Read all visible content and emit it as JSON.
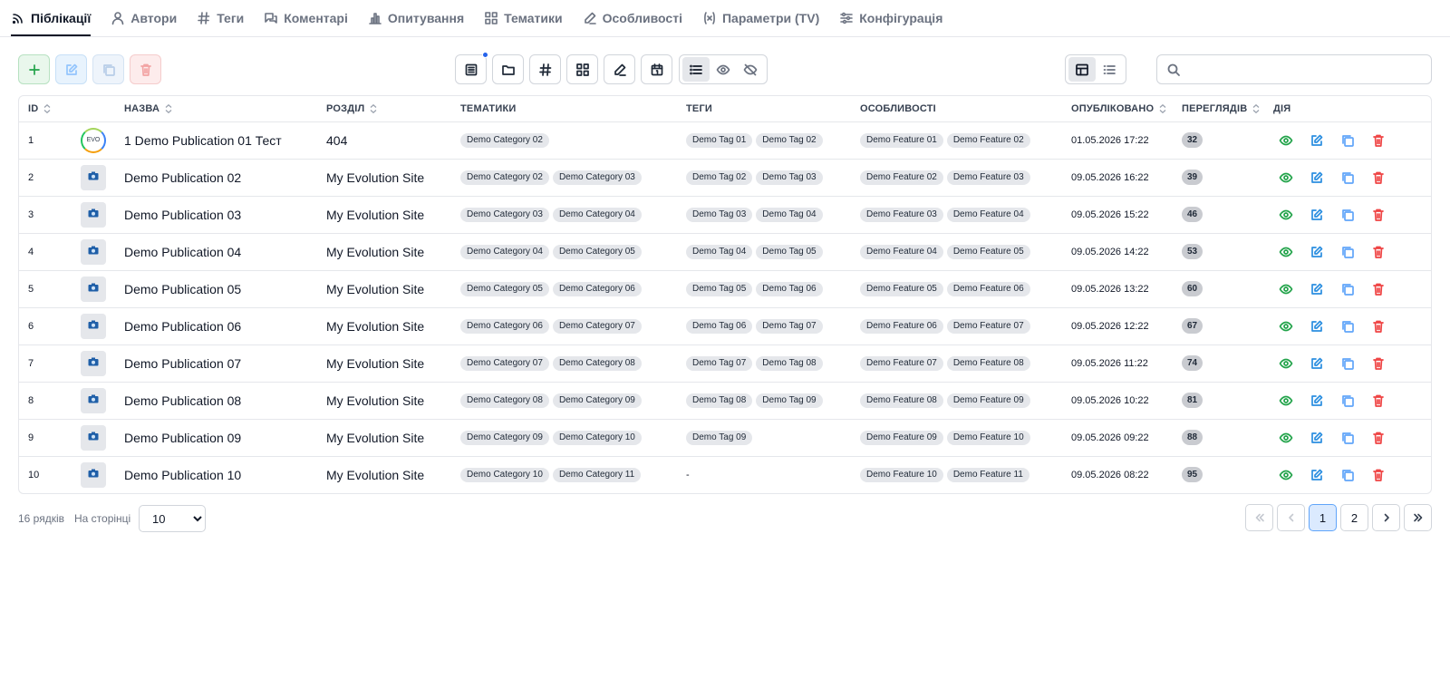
{
  "tabs": [
    {
      "label": "Піблікації",
      "icon": "rss-icon",
      "active": true
    },
    {
      "label": "Автори",
      "icon": "user-icon"
    },
    {
      "label": "Теги",
      "icon": "hash-icon"
    },
    {
      "label": "Коментарі",
      "icon": "comments-icon"
    },
    {
      "label": "Опитування",
      "icon": "bar-chart-icon"
    },
    {
      "label": "Тематики",
      "icon": "grid-icon"
    },
    {
      "label": "Особливості",
      "icon": "pen-icon"
    },
    {
      "label": "Параметри (TV)",
      "icon": "variable-icon"
    },
    {
      "label": "Конфігурація",
      "icon": "sliders-icon"
    }
  ],
  "toolbar": {
    "left_buttons": [
      "add-icon",
      "edit-icon",
      "copy-icon",
      "delete-icon"
    ],
    "center_buttons": [
      "document-icon",
      "folder-icon",
      "hash-icon",
      "grid-icon",
      "pen-icon",
      "calendar-icon"
    ],
    "visibility_toggle": [
      "list-icon",
      "eye-icon",
      "eye-off-icon"
    ],
    "view_toggle": [
      "table-icon",
      "list-view-icon"
    ],
    "search_placeholder": ""
  },
  "columns": {
    "id": "ID",
    "name": "НАЗВА",
    "section": "РОЗДІЛ",
    "categories": "ТЕМАТИКИ",
    "tags": "ТЕГИ",
    "features": "ОСОБЛИВОСТІ",
    "published": "ОПУБЛІКОВАНО",
    "views": "ПЕРЕГЛЯДІВ",
    "action": "ДІЯ"
  },
  "rows": [
    {
      "id": "1",
      "thumb": "logo",
      "logo_text": "EVO",
      "name": "1 Demo Publication 01 Тест",
      "section": "404",
      "categories": [
        "Demo Category 02"
      ],
      "tags": [
        "Demo Tag 01",
        "Demo Tag 02"
      ],
      "tags_empty": "",
      "features": [
        "Demo Feature 01",
        "Demo Feature 02"
      ],
      "published": "01.05.2026 17:22",
      "views": "32"
    },
    {
      "id": "2",
      "thumb": "image",
      "name": "Demo Publication 02",
      "section": "My Evolution Site",
      "categories": [
        "Demo Category 02",
        "Demo Category 03"
      ],
      "tags": [
        "Demo Tag 02",
        "Demo Tag 03"
      ],
      "tags_empty": "",
      "features": [
        "Demo Feature 02",
        "Demo Feature 03"
      ],
      "published": "09.05.2026 16:22",
      "views": "39"
    },
    {
      "id": "3",
      "thumb": "image",
      "name": "Demo Publication 03",
      "section": "My Evolution Site",
      "categories": [
        "Demo Category 03",
        "Demo Category 04"
      ],
      "tags": [
        "Demo Tag 03",
        "Demo Tag 04"
      ],
      "tags_empty": "",
      "features": [
        "Demo Feature 03",
        "Demo Feature 04"
      ],
      "published": "09.05.2026 15:22",
      "views": "46"
    },
    {
      "id": "4",
      "thumb": "image",
      "name": "Demo Publication 04",
      "section": "My Evolution Site",
      "categories": [
        "Demo Category 04",
        "Demo Category 05"
      ],
      "tags": [
        "Demo Tag 04",
        "Demo Tag 05"
      ],
      "tags_empty": "",
      "features": [
        "Demo Feature 04",
        "Demo Feature 05"
      ],
      "published": "09.05.2026 14:22",
      "views": "53"
    },
    {
      "id": "5",
      "thumb": "image",
      "name": "Demo Publication 05",
      "section": "My Evolution Site",
      "categories": [
        "Demo Category 05",
        "Demo Category 06"
      ],
      "tags": [
        "Demo Tag 05",
        "Demo Tag 06"
      ],
      "tags_empty": "",
      "features": [
        "Demo Feature 05",
        "Demo Feature 06"
      ],
      "published": "09.05.2026 13:22",
      "views": "60"
    },
    {
      "id": "6",
      "thumb": "image",
      "name": "Demo Publication 06",
      "section": "My Evolution Site",
      "categories": [
        "Demo Category 06",
        "Demo Category 07"
      ],
      "tags": [
        "Demo Tag 06",
        "Demo Tag 07"
      ],
      "tags_empty": "",
      "features": [
        "Demo Feature 06",
        "Demo Feature 07"
      ],
      "published": "09.05.2026 12:22",
      "views": "67"
    },
    {
      "id": "7",
      "thumb": "image",
      "name": "Demo Publication 07",
      "section": "My Evolution Site",
      "categories": [
        "Demo Category 07",
        "Demo Category 08"
      ],
      "tags": [
        "Demo Tag 07",
        "Demo Tag 08"
      ],
      "tags_empty": "",
      "features": [
        "Demo Feature 07",
        "Demo Feature 08"
      ],
      "published": "09.05.2026 11:22",
      "views": "74"
    },
    {
      "id": "8",
      "thumb": "image",
      "name": "Demo Publication 08",
      "section": "My Evolution Site",
      "categories": [
        "Demo Category 08",
        "Demo Category 09"
      ],
      "tags": [
        "Demo Tag 08",
        "Demo Tag 09"
      ],
      "tags_empty": "",
      "features": [
        "Demo Feature 08",
        "Demo Feature 09"
      ],
      "published": "09.05.2026 10:22",
      "views": "81"
    },
    {
      "id": "9",
      "thumb": "image",
      "name": "Demo Publication 09",
      "section": "My Evolution Site",
      "categories": [
        "Demo Category 09",
        "Demo Category 10"
      ],
      "tags": [
        "Demo Tag 09"
      ],
      "tags_empty": "",
      "features": [
        "Demo Feature 09",
        "Demo Feature 10"
      ],
      "published": "09.05.2026 09:22",
      "views": "88"
    },
    {
      "id": "10",
      "thumb": "image",
      "name": "Demo Publication 10",
      "section": "My Evolution Site",
      "categories": [
        "Demo Category 10",
        "Demo Category 11"
      ],
      "tags": [],
      "tags_empty": "-",
      "features": [
        "Demo Feature 10",
        "Demo Feature 11"
      ],
      "published": "09.05.2026 08:22",
      "views": "95"
    }
  ],
  "footer": {
    "rows_count": "16 рядків",
    "per_page_label": "На сторінці",
    "per_page_value": "10",
    "pages": [
      "1",
      "2"
    ],
    "current_page": "1"
  },
  "colors": {
    "active_tab": "#111827",
    "view_action": "#22a34a",
    "edit_action": "#2b8ee0",
    "copy_action": "#60a5fa",
    "delete_action": "#ef4444",
    "chip_bg": "#e5e7eb",
    "page_active_bg": "#dbeafe"
  }
}
